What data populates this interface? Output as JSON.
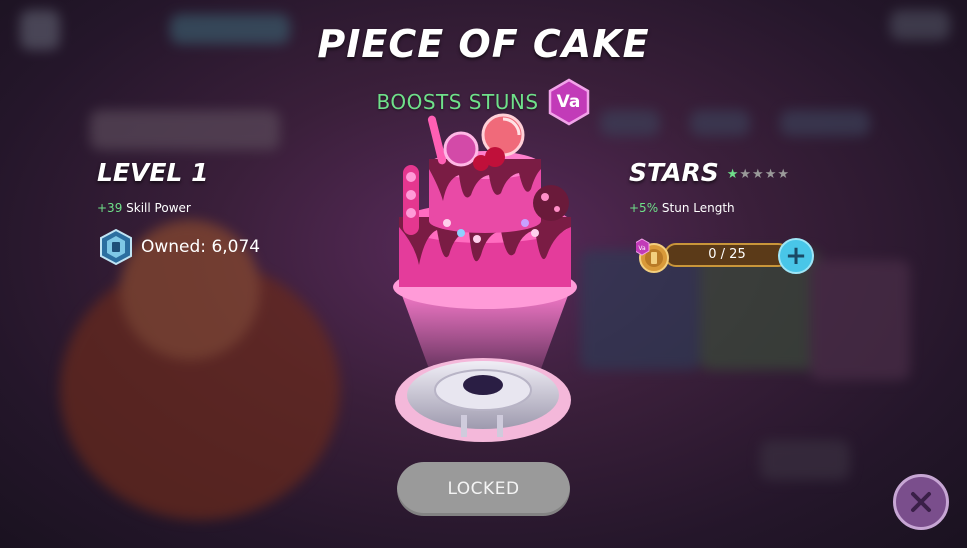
{
  "item": {
    "title": "PIECE OF CAKE",
    "boost_text": "BOOSTS STUNS",
    "badge_label": "Va"
  },
  "level": {
    "title": "LEVEL 1",
    "bonus_value": "+39",
    "bonus_label": "Skill Power",
    "owned_text": "Owned: 6,074"
  },
  "stars": {
    "title": "STARS",
    "filled": 1,
    "total": 5,
    "bonus_value": "+5%",
    "bonus_label": "Stun Length",
    "token_badge": "Va",
    "progress_text": "0 / 25",
    "progress_fraction": 0,
    "plus_label": "+"
  },
  "actions": {
    "locked_label": "LOCKED",
    "close_label": "✕"
  },
  "colors": {
    "accent_green": "#6fe08a",
    "badge_magenta": "#c23bb8",
    "progress_gold": "#c9963a",
    "plus_blue": "#49c6e8",
    "close_purple": "#7a4e8c"
  },
  "icons": {
    "owned": "shield-emblem-icon",
    "token": "gold-token-icon",
    "close": "close-icon"
  }
}
